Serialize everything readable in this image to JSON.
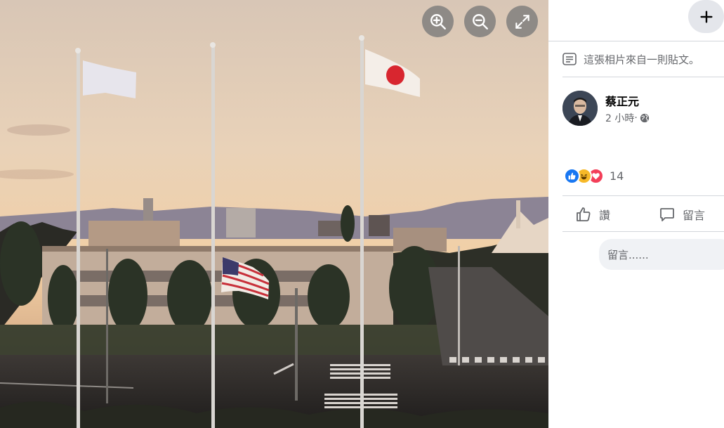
{
  "viewer": {
    "photo_subject": "Flags of Japan, the United States and a white flag on three flagpoles at sunset",
    "controls": {
      "zoom_in_icon": "zoom-in-icon",
      "zoom_out_icon": "zoom-out-icon",
      "fullscreen_icon": "expand-icon"
    }
  },
  "panel": {
    "add_icon": "plus-icon",
    "post_note": "這張相片來自一則貼文。",
    "author": {
      "name": "蔡正元",
      "time": "2 小時",
      "separator": " · ",
      "privacy_icon": "globe-icon"
    },
    "reactions": {
      "icons": [
        "like-icon",
        "haha-icon",
        "love-icon"
      ],
      "count": "14"
    },
    "actions": {
      "like_label": "讚",
      "comment_label": "留言"
    },
    "comment_input": {
      "placeholder": "留言......"
    }
  },
  "colors": {
    "panel_bg": "#ffffff",
    "text_secondary": "#65676b",
    "like_blue": "#1877f2",
    "haha_yellow": "#f7b928",
    "love_red": "#f33e58",
    "japan_red": "#d8262f"
  }
}
